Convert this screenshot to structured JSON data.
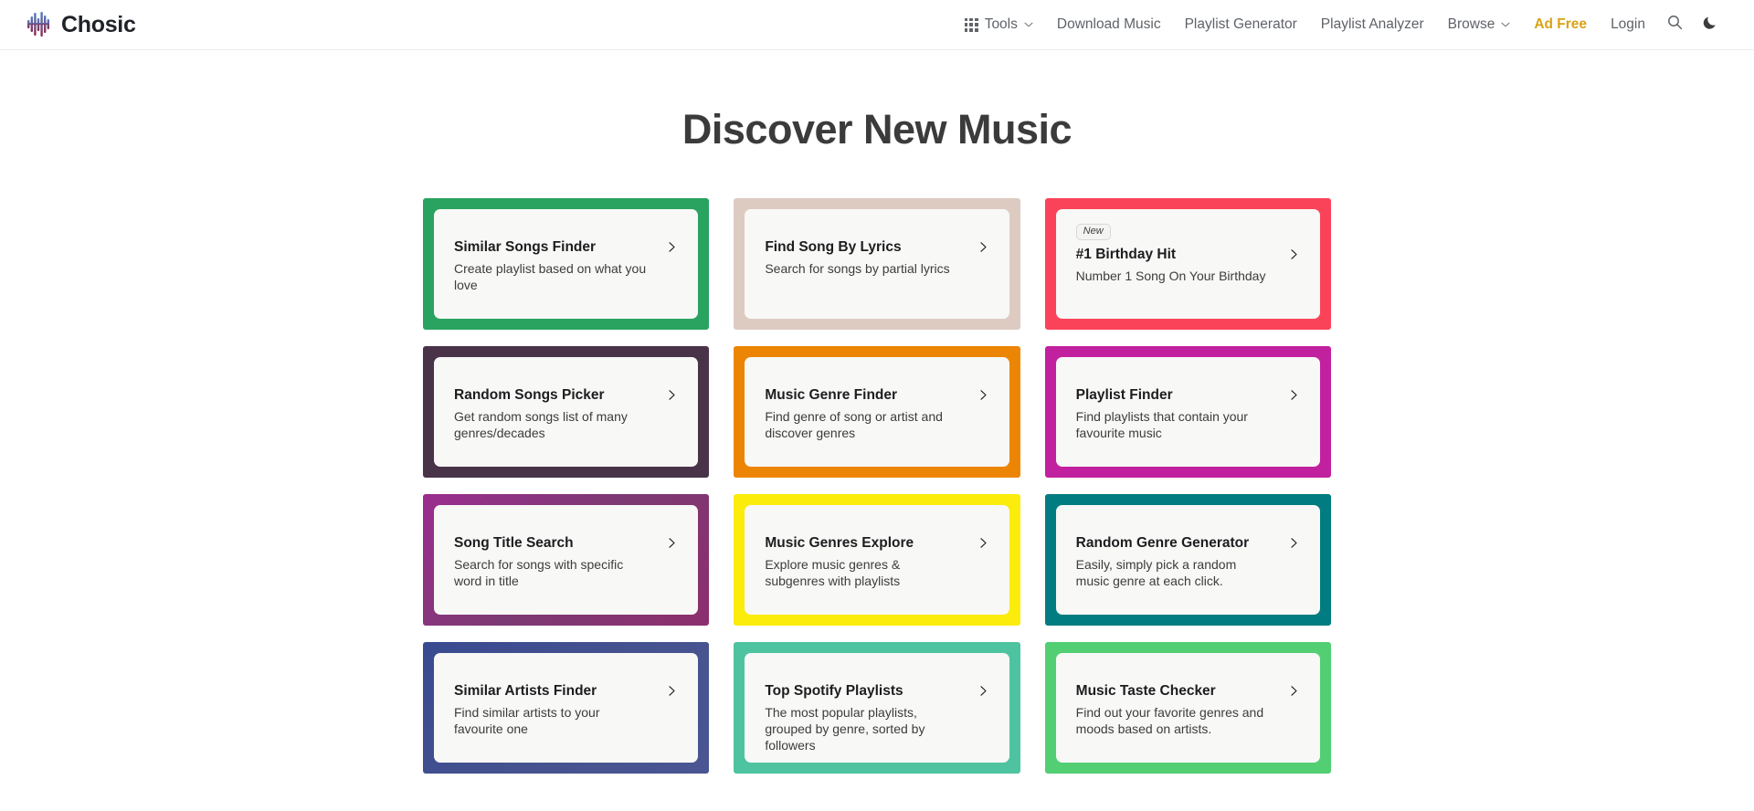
{
  "header": {
    "brand": {
      "name": "Chosic",
      "logo_icon": "equalizer-bars-logo"
    },
    "nav": [
      {
        "id": "tools",
        "label": "Tools",
        "icon": "grid-icon",
        "caret": true,
        "accent": false
      },
      {
        "id": "download-music",
        "label": "Download Music",
        "icon": null,
        "caret": false,
        "accent": false
      },
      {
        "id": "playlist-generator",
        "label": "Playlist Generator",
        "icon": null,
        "caret": false,
        "accent": false
      },
      {
        "id": "playlist-analyzer",
        "label": "Playlist Analyzer",
        "icon": null,
        "caret": false,
        "accent": false
      },
      {
        "id": "browse",
        "label": "Browse",
        "icon": null,
        "caret": true,
        "accent": false
      },
      {
        "id": "ad-free",
        "label": "Ad Free",
        "icon": null,
        "caret": false,
        "accent": true
      },
      {
        "id": "login",
        "label": "Login",
        "icon": null,
        "caret": false,
        "accent": false
      }
    ],
    "search_icon": "search-icon",
    "dark_mode_icon": "moon-icon",
    "accent_color": "#d9a216",
    "text_color": "#5f6368"
  },
  "main": {
    "title": "Discover New Music",
    "chevron_icon": "chevron-right-icon",
    "cards": [
      {
        "id": "similar-songs-finder",
        "title": "Similar Songs Finder",
        "desc": "Create playlist based on what you love",
        "badge": null,
        "frame": "#2aa260"
      },
      {
        "id": "find-song-by-lyrics",
        "title": "Find Song By Lyrics",
        "desc": "Search for songs by partial lyrics",
        "badge": null,
        "frame": "#ddcbc2"
      },
      {
        "id": "number-1-birthday-hit",
        "title": "#1 Birthday Hit",
        "desc": "Number 1 Song On Your Birthday",
        "badge": "New",
        "frame": "#fa4359"
      },
      {
        "id": "random-songs-picker",
        "title": "Random Songs Picker",
        "desc": "Get random songs list of many genres/decades",
        "badge": null,
        "frame": "#483348"
      },
      {
        "id": "music-genre-finder",
        "title": "Music Genre Finder",
        "desc": "Find genre of song or artist and discover genres",
        "badge": null,
        "frame": "#ec8503"
      },
      {
        "id": "playlist-finder",
        "title": "Playlist Finder",
        "desc": "Find playlists that contain your favourite music",
        "badge": null,
        "frame": "#c1219e"
      },
      {
        "id": "song-title-search",
        "title": "Song Title Search",
        "desc": "Search for songs with specific word in title",
        "badge": null,
        "frame": "linear-gradient(135deg, #9b2d8f 0%, #7c3a72 50%, #8d2e6e 100%)"
      },
      {
        "id": "music-genres-explore",
        "title": "Music Genres Explore",
        "desc": "Explore music genres & subgenres with playlists",
        "badge": null,
        "frame": "#fbec0c"
      },
      {
        "id": "random-genre-generator",
        "title": "Random Genre Generator",
        "desc": "Easily, simply pick a random music genre at each click.",
        "badge": null,
        "frame": "#017c80"
      },
      {
        "id": "similar-artists-finder",
        "title": "Similar Artists Finder",
        "desc": "Find similar artists to your favourite one",
        "badge": null,
        "frame": "linear-gradient(135deg, #3a4a90 0%, #46538f 60%, #4a5593 100%)"
      },
      {
        "id": "top-spotify-playlists",
        "title": "Top Spotify Playlists",
        "desc": "The most popular playlists, grouped by genre, sorted by followers",
        "badge": null,
        "frame": "#4ec3a0"
      },
      {
        "id": "music-taste-checker",
        "title": "Music Taste Checker",
        "desc": "Find out your favorite genres and moods based on artists.",
        "badge": null,
        "frame": "#52ce73"
      }
    ]
  }
}
